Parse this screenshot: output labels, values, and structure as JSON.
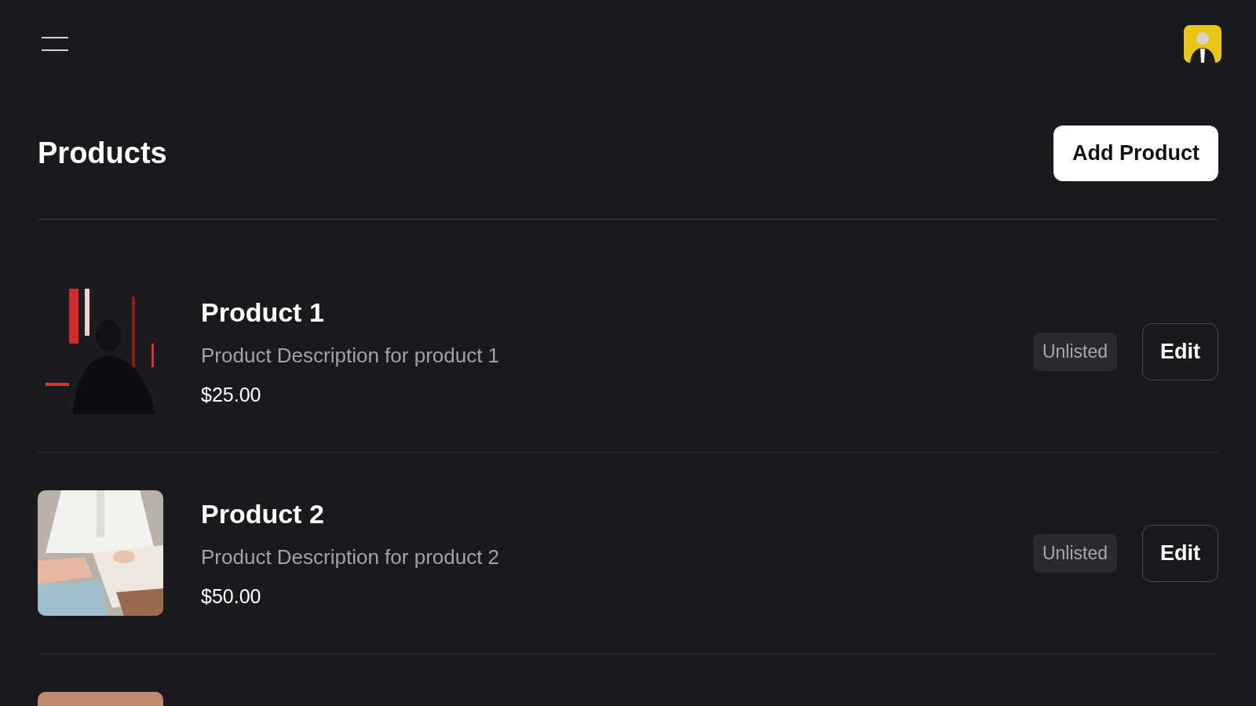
{
  "page": {
    "title": "Products",
    "add_button": "Add Product"
  },
  "products": [
    {
      "kind": "full",
      "title": "Product 1",
      "description": "Product Description for product 1",
      "price": "$25.00",
      "status": "Unlisted",
      "edit": "Edit"
    },
    {
      "kind": "full",
      "title": "Product 2",
      "description": "Product Description for product 2",
      "price": "$50.00",
      "status": "Unlisted",
      "edit": "Edit"
    },
    {
      "kind": "cut_off"
    }
  ]
}
